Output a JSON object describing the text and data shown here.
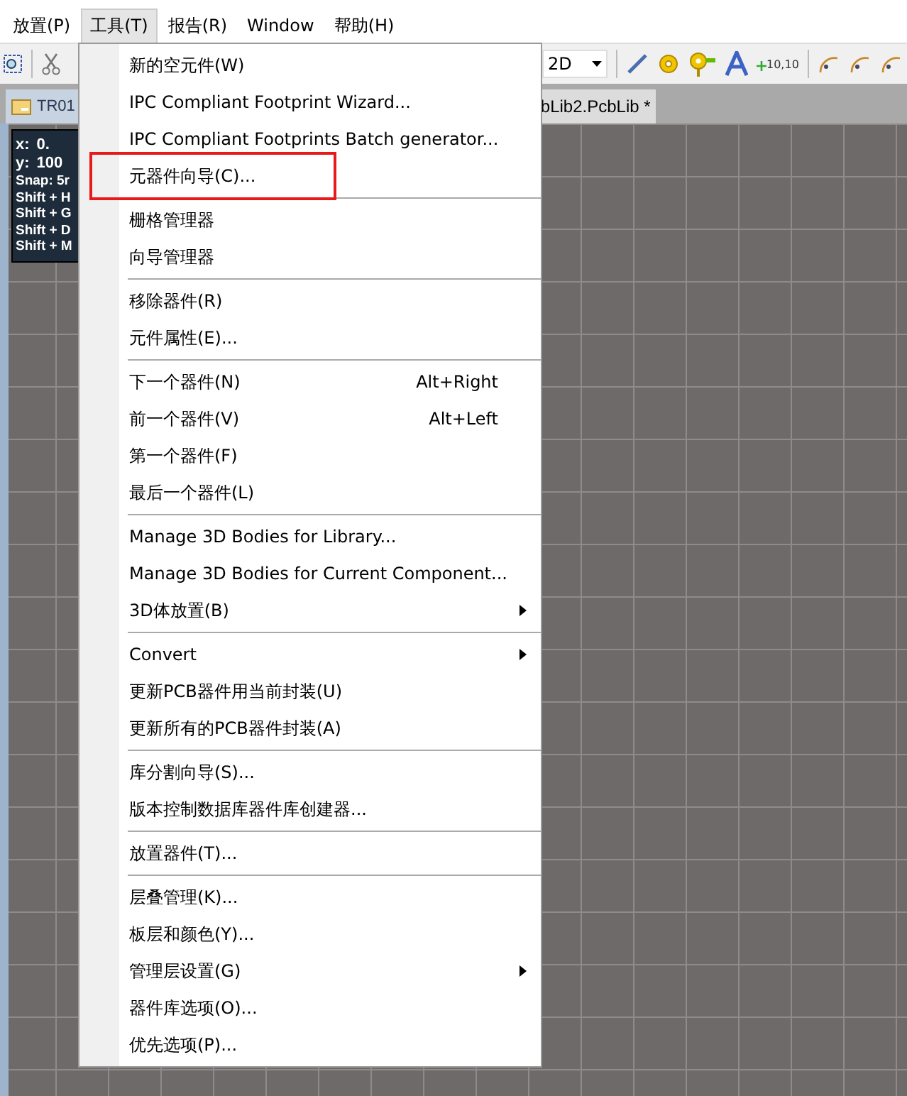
{
  "menubar": [
    {
      "label": "放置(P)",
      "selected": false
    },
    {
      "label": "工具(T)",
      "selected": true
    },
    {
      "label": "报告(R)",
      "selected": false
    },
    {
      "label": "Window",
      "selected": false
    },
    {
      "label": "帮助(H)",
      "selected": false
    }
  ],
  "toolbar": {
    "view_mode": "2D",
    "coordinate_label": "10,10"
  },
  "tabs": [
    {
      "label": "TR01",
      "selected": false
    },
    {
      "label": "bLib2.PcbLib *",
      "selected": true
    }
  ],
  "info_panel": {
    "x_label": "x:",
    "x_value": "0.",
    "y_label": "y:",
    "y_value": "100",
    "lines": [
      "Snap: 5r",
      "Shift + H",
      "Shift + G",
      "Shift + D",
      "Shift + M"
    ]
  },
  "menu": {
    "groups": [
      [
        {
          "label": "新的空元件(W)",
          "submenu": false
        },
        {
          "label": "IPC Compliant Footprint Wizard...",
          "submenu": false
        },
        {
          "label": "IPC Compliant Footprints Batch generator...",
          "submenu": false
        },
        {
          "label": "元器件向导(C)...",
          "submenu": false,
          "highlighted": true
        }
      ],
      [
        {
          "label": "栅格管理器",
          "submenu": false
        },
        {
          "label": "向导管理器",
          "submenu": false
        }
      ],
      [
        {
          "label": "移除器件(R)",
          "submenu": false
        },
        {
          "label": "元件属性(E)...",
          "submenu": false
        }
      ],
      [
        {
          "label": "下一个器件(N)",
          "shortcut": "Alt+Right",
          "submenu": false
        },
        {
          "label": "前一个器件(V)",
          "shortcut": "Alt+Left",
          "submenu": false
        },
        {
          "label": "第一个器件(F)",
          "submenu": false
        },
        {
          "label": "最后一个器件(L)",
          "submenu": false
        }
      ],
      [
        {
          "label": "Manage 3D Bodies for Library...",
          "submenu": false
        },
        {
          "label": "Manage 3D Bodies for Current Component...",
          "submenu": false
        },
        {
          "label": "3D体放置(B)",
          "submenu": true
        }
      ],
      [
        {
          "label": "Convert",
          "submenu": true
        },
        {
          "label": "更新PCB器件用当前封装(U)",
          "submenu": false
        },
        {
          "label": "更新所有的PCB器件封装(A)",
          "submenu": false
        }
      ],
      [
        {
          "label": "库分割向导(S)...",
          "submenu": false
        },
        {
          "label": "版本控制数据库器件库创建器...",
          "submenu": false
        }
      ],
      [
        {
          "label": "放置器件(T)...",
          "submenu": false
        }
      ],
      [
        {
          "label": "层叠管理(K)...",
          "submenu": false
        },
        {
          "label": "板层和颜色(Y)...",
          "submenu": false
        },
        {
          "label": "管理层设置(G)",
          "submenu": true
        },
        {
          "label": "器件库选项(O)...",
          "submenu": false
        },
        {
          "label": "优先选项(P)...",
          "submenu": false
        }
      ]
    ]
  }
}
